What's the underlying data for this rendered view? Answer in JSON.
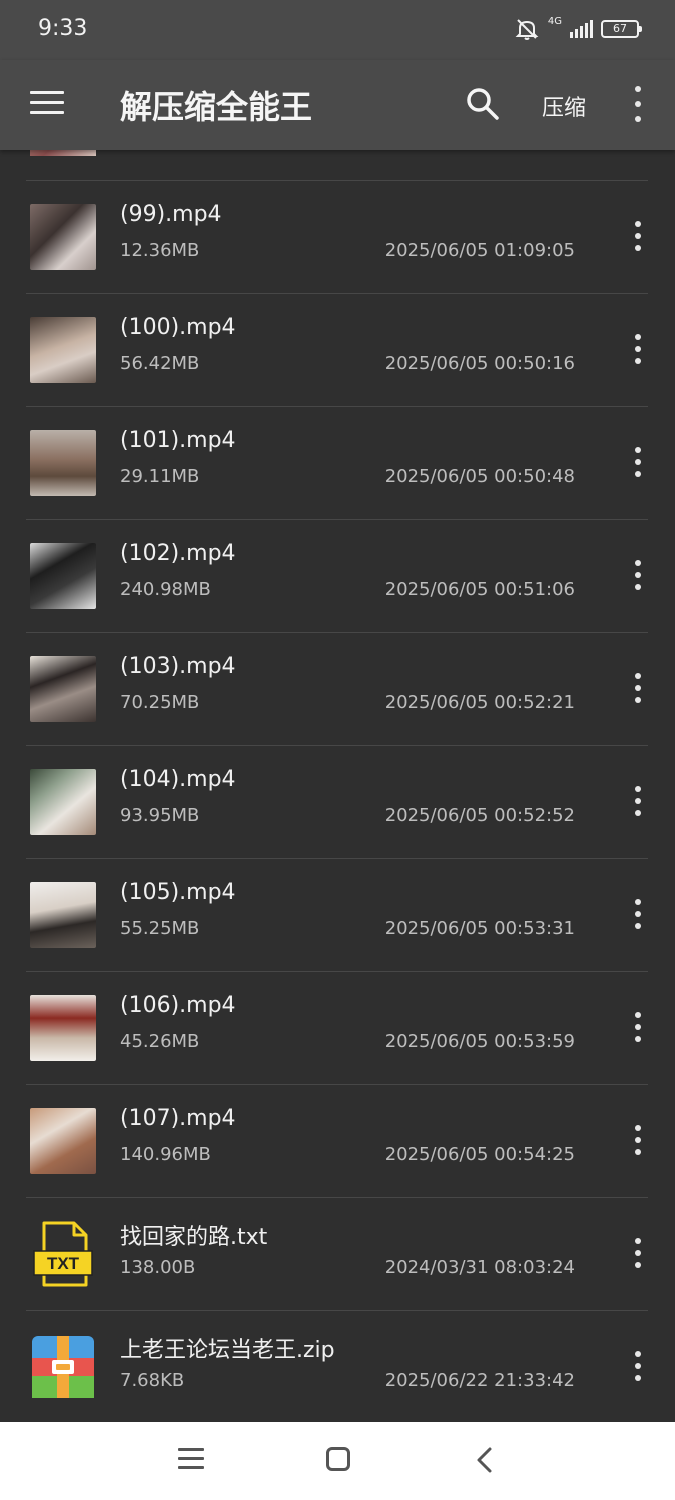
{
  "status": {
    "time": "9:33",
    "network": "4G",
    "battery": "67"
  },
  "app_bar": {
    "title": "解压缩全能王",
    "compress_label": "压缩"
  },
  "files": [
    {
      "name": "(99).mp4",
      "size": "12.36MB",
      "date": "2025/06/05 01:09:05",
      "thumb": "video"
    },
    {
      "name": "(100).mp4",
      "size": "56.42MB",
      "date": "2025/06/05 00:50:16",
      "thumb": "video"
    },
    {
      "name": "(101).mp4",
      "size": "29.11MB",
      "date": "2025/06/05 00:50:48",
      "thumb": "video"
    },
    {
      "name": "(102).mp4",
      "size": "240.98MB",
      "date": "2025/06/05 00:51:06",
      "thumb": "video"
    },
    {
      "name": "(103).mp4",
      "size": "70.25MB",
      "date": "2025/06/05 00:52:21",
      "thumb": "video"
    },
    {
      "name": "(104).mp4",
      "size": "93.95MB",
      "date": "2025/06/05 00:52:52",
      "thumb": "video"
    },
    {
      "name": "(105).mp4",
      "size": "55.25MB",
      "date": "2025/06/05 00:53:31",
      "thumb": "video"
    },
    {
      "name": "(106).mp4",
      "size": "45.26MB",
      "date": "2025/06/05 00:53:59",
      "thumb": "video"
    },
    {
      "name": "(107).mp4",
      "size": "140.96MB",
      "date": "2025/06/05 00:54:25",
      "thumb": "video"
    },
    {
      "name": "找回家的路.txt",
      "size": "138.00B",
      "date": "2024/03/31 08:03:24",
      "thumb": "txt",
      "badge": "TXT"
    },
    {
      "name": "上老王论坛当老王.zip",
      "size": "7.68KB",
      "date": "2025/06/22 21:33:42",
      "thumb": "zip"
    }
  ],
  "colors": {
    "app_bar_bg": "#4a4a4a",
    "list_bg": "#2f2f2f",
    "txt_icon_yellow": "#f5d324",
    "zip_blue": "#4a9fe0",
    "zip_red": "#e8554e",
    "zip_green": "#6cc04a",
    "zip_orange": "#f3a93a"
  },
  "icons": {
    "menu": "hamburger-menu-icon",
    "search": "search-icon",
    "overflow": "more-vertical-icon",
    "status_sound": "bell-off-icon",
    "nav_recents": "recents-icon",
    "nav_home": "home-icon",
    "nav_back": "back-icon"
  }
}
